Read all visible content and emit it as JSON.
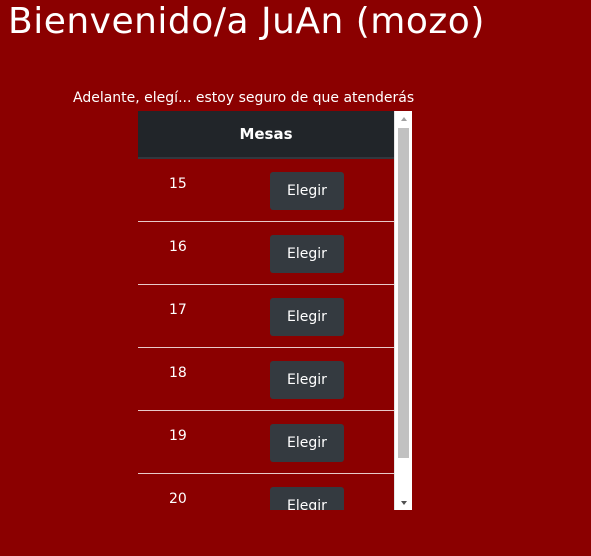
{
  "header": {
    "title": "Bienvenido/a JuAn (mozo)",
    "subtitle": "Adelante, elegí... estoy seguro de que atenderás"
  },
  "table": {
    "column_header": "Mesas",
    "rows": [
      {
        "number": "15",
        "button_label": "Elegir"
      },
      {
        "number": "16",
        "button_label": "Elegir"
      },
      {
        "number": "17",
        "button_label": "Elegir"
      },
      {
        "number": "18",
        "button_label": "Elegir"
      },
      {
        "number": "19",
        "button_label": "Elegir"
      },
      {
        "number": "20",
        "button_label": "Elegir"
      }
    ]
  },
  "colors": {
    "background": "#8b0000",
    "table_header": "#212529",
    "button": "#343a40",
    "text": "#ffffff"
  },
  "icons": {
    "scroll_up": "chevron-up-icon",
    "scroll_down": "chevron-down-icon"
  }
}
